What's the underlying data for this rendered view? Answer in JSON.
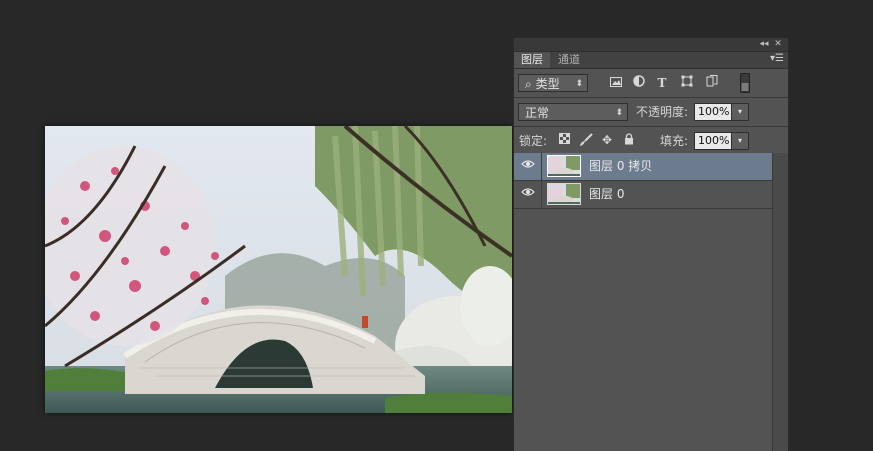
{
  "window": {
    "collapse_label": "◂◂",
    "close_label": "✕"
  },
  "tabs": [
    {
      "label": "图层",
      "active": true
    },
    {
      "label": "通道",
      "active": false
    }
  ],
  "tab_menu_label": "▾☰",
  "filter": {
    "kind_label": "类型",
    "icons": [
      "image-filter-icon",
      "adjustment-filter-icon",
      "type-filter-icon",
      "shape-filter-icon",
      "smart-object-filter-icon",
      "filter-toggle-icon"
    ]
  },
  "blend": {
    "mode": "正常",
    "opacity_label": "不透明度:",
    "opacity_value": "100%"
  },
  "lock": {
    "label": "锁定:",
    "fill_label": "填充:",
    "fill_value": "100%"
  },
  "layers": [
    {
      "name": "图层 0 拷贝",
      "selected": true,
      "visible": true
    },
    {
      "name": "图层 0",
      "selected": false,
      "visible": true
    }
  ],
  "colors": {
    "workspace": "#282828",
    "panel": "#535353",
    "selected_layer": "#6d7b8e"
  }
}
